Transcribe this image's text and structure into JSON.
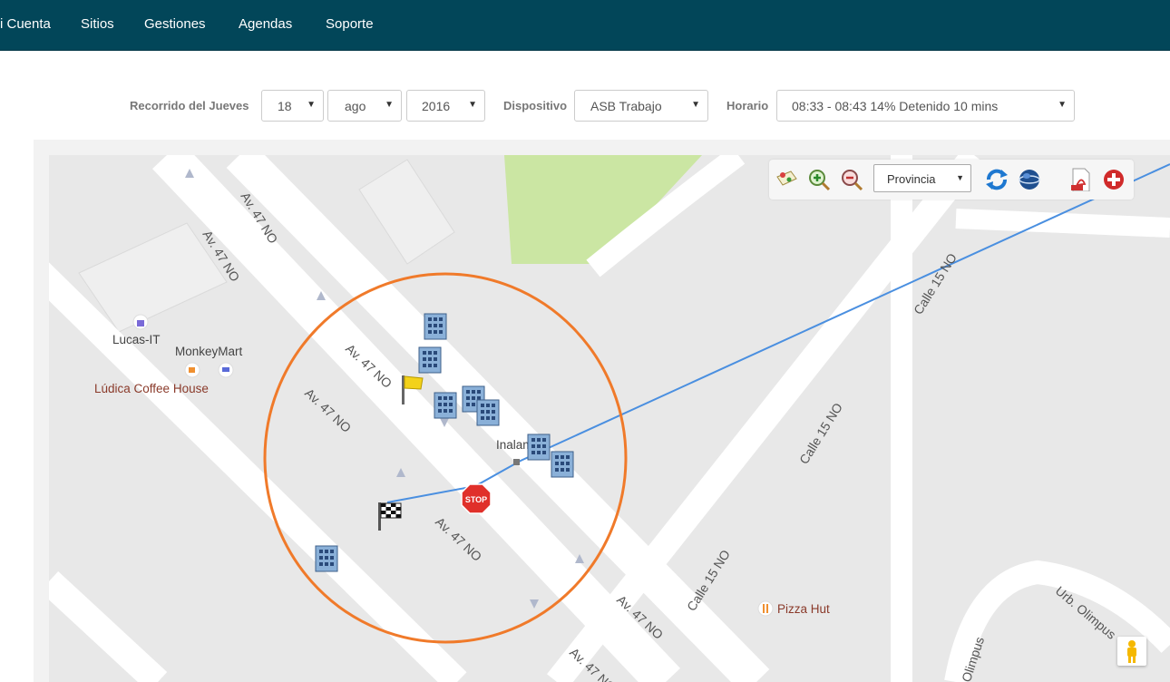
{
  "nav": {
    "items": [
      "i Cuenta",
      "Sitios",
      "Gestiones",
      "Agendas",
      "Soporte"
    ]
  },
  "filters": {
    "route_label": "Recorrido del Jueves",
    "day": "18",
    "month": "ago",
    "year": "2016",
    "device_label": "Dispositivo",
    "device": "ASB Trabajo",
    "schedule_label": "Horario",
    "schedule": "08:33 - 08:43 14% Detenido 10 mins"
  },
  "map_toolbar": {
    "region_select": "Provincia",
    "icons": [
      "layers-icon",
      "zoom-in-icon",
      "zoom-out-icon",
      "refresh-icon",
      "globe-icon",
      "pdf-icon",
      "add-icon"
    ]
  },
  "map": {
    "road_labels": [
      "Av. 47 NO",
      "Av. 47 NO",
      "Av. 47 NO",
      "Av. 47 NO",
      "Av. 47 NO",
      "Av. 47 NO",
      "Av. 47 NO",
      "Calle 15 NO",
      "Calle 15 NO",
      "Calle 15 NO",
      "Urb. Olimpus",
      "Olimpus"
    ],
    "pois": {
      "lucas": "Lucas-IT",
      "monkey": "MonkeyMart",
      "coffee": "Lúdica Coffee House",
      "pizza": "Pizza Hut",
      "inalam": "Inalam"
    },
    "markers": {
      "start": "start-flag-icon",
      "end": "finish-flag-icon",
      "stop": "STOP"
    },
    "colors": {
      "route": "#4a8fe0",
      "circle": "#f07a2a",
      "navbar": "#024659",
      "park": "#cbe6a3"
    }
  }
}
